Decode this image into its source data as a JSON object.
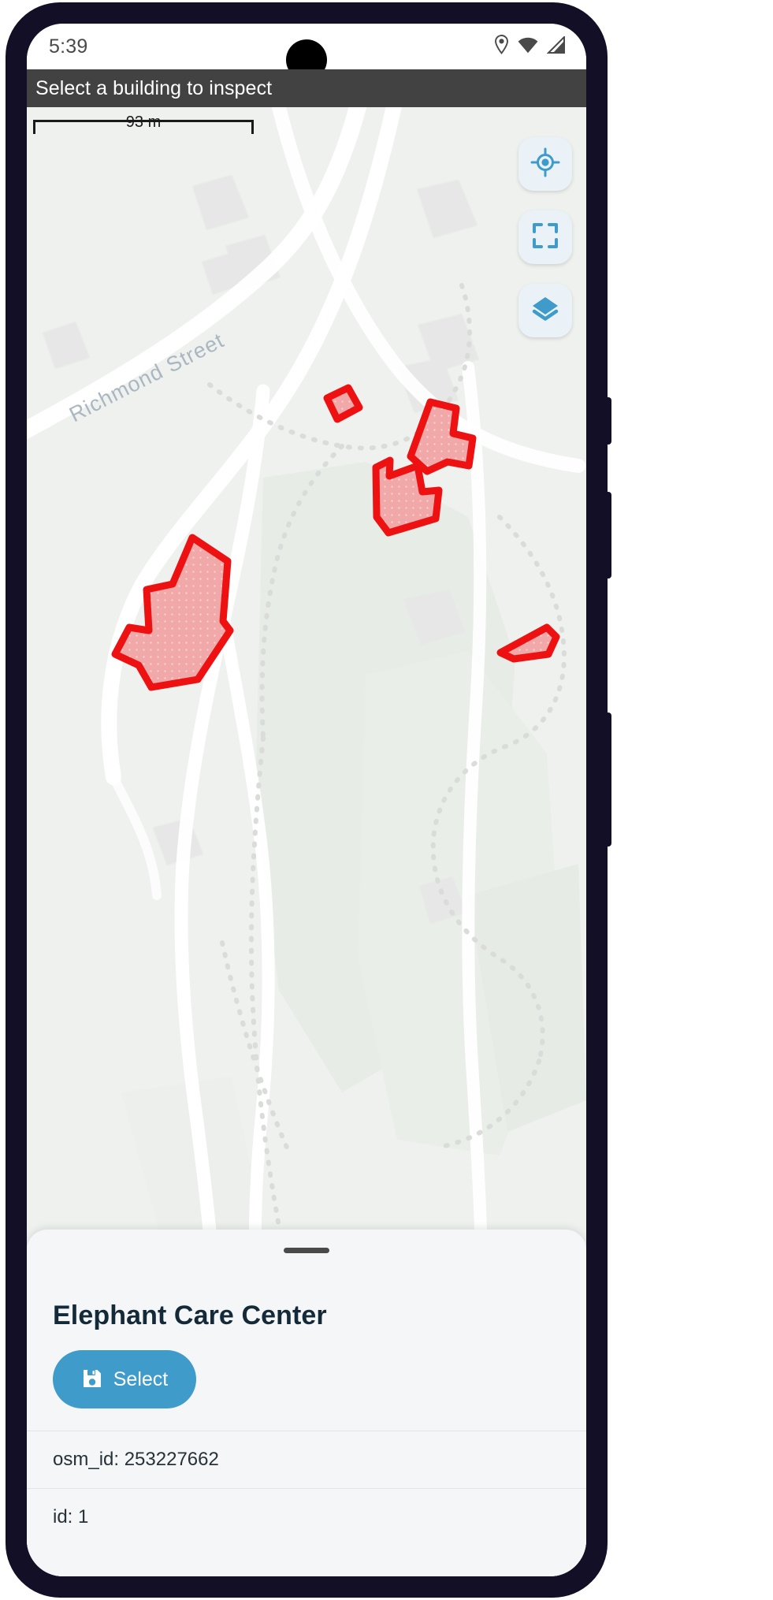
{
  "status_bar": {
    "time": "5:39",
    "icons": [
      "location-pin-icon",
      "wifi-icon",
      "cellular-signal-icon"
    ]
  },
  "app_bar": {
    "title": "Select a building to inspect",
    "background_color": "#424242"
  },
  "map": {
    "scale_label": "93 m",
    "street_label": "Richmond Street",
    "background_color": "#eef1ee",
    "building_stroke_color": "#ee1111",
    "building_fill_color": "#f0a8a8",
    "controls": [
      {
        "name": "locate-me-button",
        "icon": "gps-crosshair-icon"
      },
      {
        "name": "fit-bounds-button",
        "icon": "fullscreen-corners-icon"
      },
      {
        "name": "layers-button",
        "icon": "map-layers-icon"
      }
    ],
    "control_accent_color": "#3f9bc9",
    "control_background_color": "#eaf2f8"
  },
  "bottom_sheet": {
    "handle": "drag-handle",
    "title": "Elephant Care Center",
    "select_button": {
      "label": "Select",
      "icon": "save-floppy-icon",
      "color": "#3f9bc9"
    },
    "attributes": [
      {
        "label": "osm_id: 253227662"
      },
      {
        "label": "id: 1"
      }
    ]
  }
}
